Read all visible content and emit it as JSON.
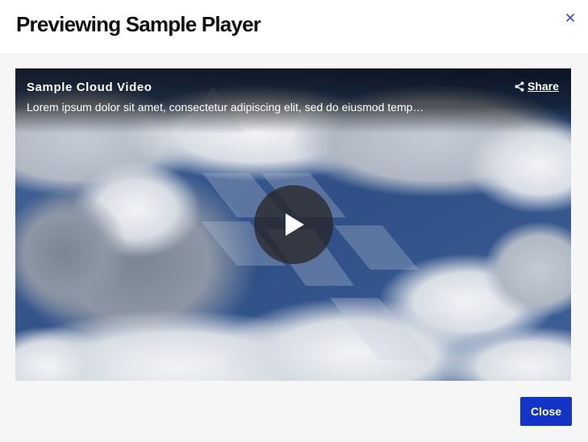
{
  "modal": {
    "title": "Previewing Sample Player",
    "close_button_label": "Close"
  },
  "player": {
    "video_title": "Sample Cloud Video",
    "video_description": "Lorem ipsum dolor sit amet, consectetur adipiscing elit, sed do eiusmod temp…",
    "share_label": "Share"
  },
  "icons": {
    "close": "close-icon",
    "share": "share-icon",
    "play": "play-icon"
  },
  "colors": {
    "accent": "#1433c7",
    "close_x": "#3b4fc4",
    "body_bg": "#f6f6f6"
  }
}
